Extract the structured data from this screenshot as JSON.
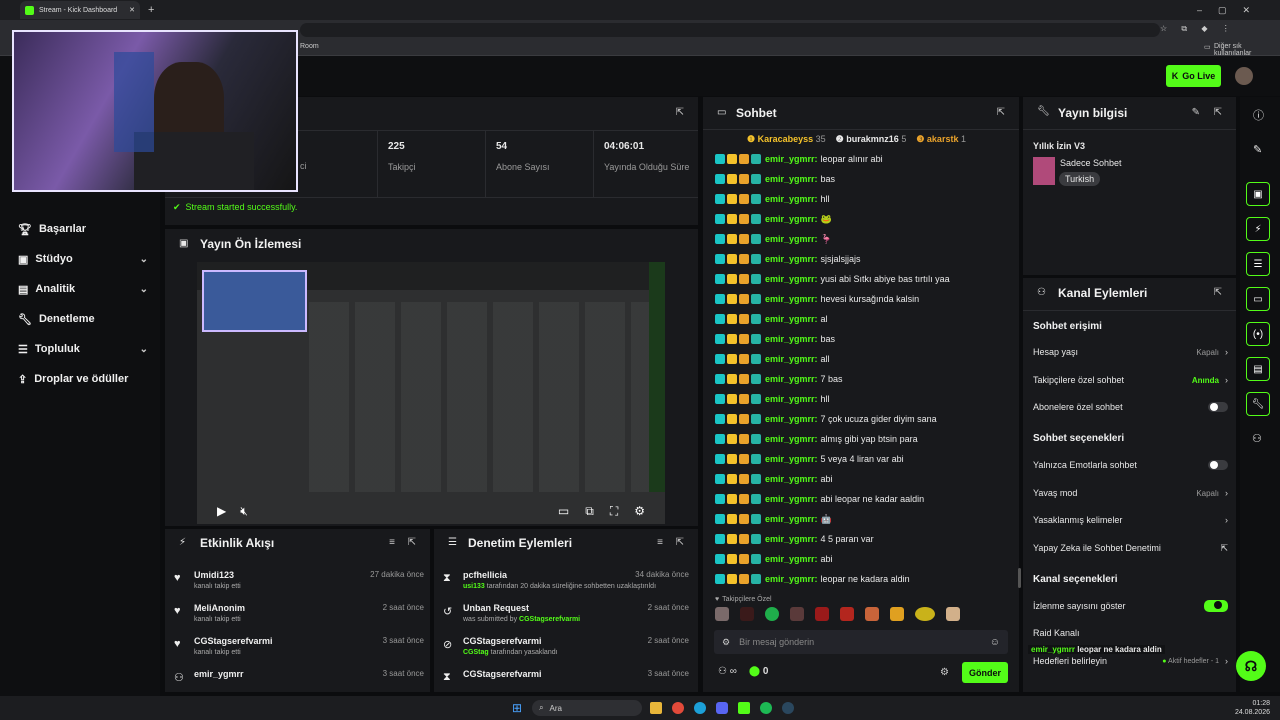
{
  "browser": {
    "tab_title": "Stream - Kick Dashboard",
    "bookmark_partial": "Room",
    "bookmarks_other": "Diğer sık kullanılanlar"
  },
  "header": {
    "go_live": "Go Live"
  },
  "colors": {
    "brand": "#53fc18",
    "bg": "#0b0c0e",
    "panel": "#18191c"
  },
  "sidebar": {
    "items": [
      {
        "label": "Başarılar",
        "icon": "trophy-icon",
        "chevron": false
      },
      {
        "label": "Stüdyo",
        "icon": "studio-icon",
        "chevron": true
      },
      {
        "label": "Analitik",
        "icon": "chart-icon",
        "chevron": true
      },
      {
        "label": "Denetleme",
        "icon": "wrench-icon",
        "chevron": false
      },
      {
        "label": "Topluluk",
        "icon": "community-icon",
        "chevron": true
      },
      {
        "label": "Droplar ve ödüller",
        "icon": "gift-icon",
        "chevron": false
      }
    ]
  },
  "stats": [
    {
      "value": "225",
      "label": "Takipçi"
    },
    {
      "value": "54",
      "label": "Abone Sayısı"
    },
    {
      "value": "04:06:01",
      "label": "Yayında Olduğu Süre"
    }
  ],
  "stats_partial_label": "ci",
  "status_message": "Stream started successfully.",
  "preview": {
    "title": "Yayın Ön İzlemesi"
  },
  "activity": {
    "title": "Etkinlik Akışı",
    "items": [
      {
        "user": "Umidi123",
        "action": "kanalı takip etti",
        "time": "27 dakika önce"
      },
      {
        "user": "MeliAnonim",
        "action": "kanalı takip etti",
        "time": "2 saat önce"
      },
      {
        "user": "CGStagserefvarmi",
        "action": "kanalı takip etti",
        "time": "3 saat önce"
      },
      {
        "user": "emir_ygmrr",
        "action": "",
        "time": "3 saat önce"
      }
    ]
  },
  "moderation": {
    "title": "Denetim Eylemleri",
    "items": [
      {
        "user": "pcfhellicia",
        "actor": "usi133",
        "detail": "tarafından 20 dakika süreliğine sohbetten uzaklaştırıldı",
        "time": "34 dakika önce"
      },
      {
        "user": "Unban Request",
        "actor": "CGStagserefvarmi",
        "detail": "was submitted by",
        "time": "2 saat önce"
      },
      {
        "user": "CGStagserefvarmi",
        "actor": "CGStag",
        "detail": "tarafından yasaklandı",
        "time": "2 saat önce"
      },
      {
        "user": "CGStagserefvarmi",
        "actor": "",
        "detail": "",
        "time": "3 saat önce"
      }
    ]
  },
  "chat": {
    "title": "Sohbet",
    "top": [
      {
        "name": "Karacabeyss",
        "count": "35",
        "color": "#f4c22b"
      },
      {
        "name": "burakmnz16",
        "count": "5",
        "color": "#e8e8e8"
      },
      {
        "name": "akarstk",
        "count": "1",
        "color": "#e9a22b"
      }
    ],
    "messages": [
      {
        "user": "emir_ygmrr:",
        "text": "leopar alınır abi"
      },
      {
        "user": "emir_ygmrr:",
        "text": "bas"
      },
      {
        "user": "emir_ygmrr:",
        "text": "hll"
      },
      {
        "user": "emir_ygmrr:",
        "text": "🐸"
      },
      {
        "user": "emir_ygmrr:",
        "text": "🦩"
      },
      {
        "user": "emir_ygmrr:",
        "text": "sjsjalsjjajs"
      },
      {
        "user": "emir_ygmrr:",
        "text": "yusi abi Sıtkı abiye bas tırtılı yaa"
      },
      {
        "user": "emir_ygmrr:",
        "text": "hevesi kursağında kalsin"
      },
      {
        "user": "emir_ygmrr:",
        "text": "al"
      },
      {
        "user": "emir_ygmrr:",
        "text": "bas"
      },
      {
        "user": "emir_ygmrr:",
        "text": "all"
      },
      {
        "user": "emir_ygmrr:",
        "text": "7 bas"
      },
      {
        "user": "emir_ygmrr:",
        "text": "hll"
      },
      {
        "user": "emir_ygmrr:",
        "text": "7 çok ucuza gider diyim sana"
      },
      {
        "user": "emir_ygmrr:",
        "text": "almış gibi yap btsin para"
      },
      {
        "user": "emir_ygmrr:",
        "text": "5 veya 4 liran var abi"
      },
      {
        "user": "emir_ygmrr:",
        "text": "abi"
      },
      {
        "user": "emir_ygmrr:",
        "text": "abi leopar ne kadar aaldin"
      },
      {
        "user": "emir_ygmrr:",
        "text": "🤖"
      },
      {
        "user": "emir_ygmrr:",
        "text": "4 5 paran var"
      },
      {
        "user": "emir_ygmrr:",
        "text": "abi"
      },
      {
        "user": "emir_ygmrr:",
        "text": "leopar ne kadara aldin"
      }
    ],
    "followers_only": "Takipçilere Özel",
    "placeholder": "Bir mesaj gönderin",
    "count": "0",
    "send": "Gönder"
  },
  "stream_info": {
    "title": "Yayın bilgisi",
    "stream_title": "Yıllık İzin V3",
    "category": "Sadece Sohbet",
    "tag": "Turkish"
  },
  "channel_actions": {
    "title": "Kanal Eylemleri",
    "chat_access": "Sohbet erişimi",
    "account_age": "Hesap yaşı",
    "account_age_val": "Kapalı",
    "followers_chat": "Takipçilere özel sohbet",
    "followers_chat_val": "Anında",
    "subs_chat": "Abonelere özel sohbet",
    "chat_options": "Sohbet seçenekleri",
    "emote_only": "Yalnızca Emotlarla sohbet",
    "slow_mode": "Yavaş mod",
    "slow_mode_val": "Kapalı",
    "banned_words": "Yasaklanmış kelimeler",
    "ai_mod": "Yapay Zeka ile Sohbet Denetimi",
    "channel_options": "Kanal seçenekleri",
    "show_viewers": "İzlenme sayısını göster",
    "raid": "Raid Kanalı",
    "goals": "Hedefleri belirleyin",
    "goals_val": "Aktif hedefler - 1",
    "overlay_user": "emir_ygmrr",
    "overlay_text": "leopar ne kadara aldin"
  },
  "taskbar": {
    "search": "Ara",
    "time": "01:28",
    "date": "24.08.2026"
  }
}
